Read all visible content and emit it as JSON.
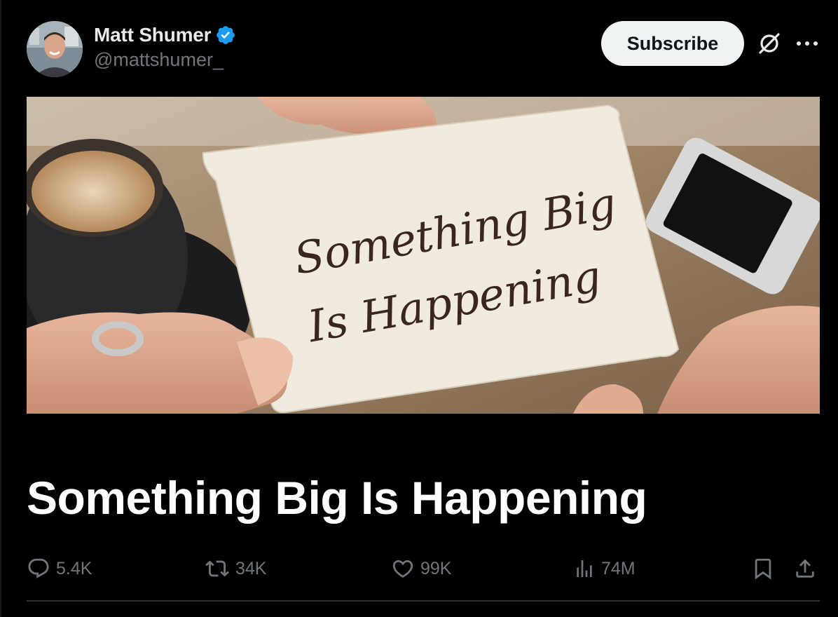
{
  "author": {
    "name": "Matt Shumer",
    "handle": "@mattshumer_",
    "verified": true
  },
  "header": {
    "subscribe_label": "Subscribe"
  },
  "article": {
    "cover_image_text": "Something Big Is Happening",
    "title": "Something Big Is Happening"
  },
  "actions": {
    "replies": "5.4K",
    "reposts": "34K",
    "likes": "99K",
    "views": "74M"
  },
  "colors": {
    "background": "#000000",
    "text_primary": "#e7e9ea",
    "text_secondary": "#71767b",
    "verified_blue": "#1d9bf0",
    "subscribe_bg": "#eff3f4",
    "divider": "#2f3336"
  },
  "icons": [
    "verified-badge-icon",
    "grok-icon",
    "more-icon",
    "reply-icon",
    "repost-icon",
    "like-icon",
    "views-icon",
    "bookmark-icon",
    "share-icon"
  ]
}
